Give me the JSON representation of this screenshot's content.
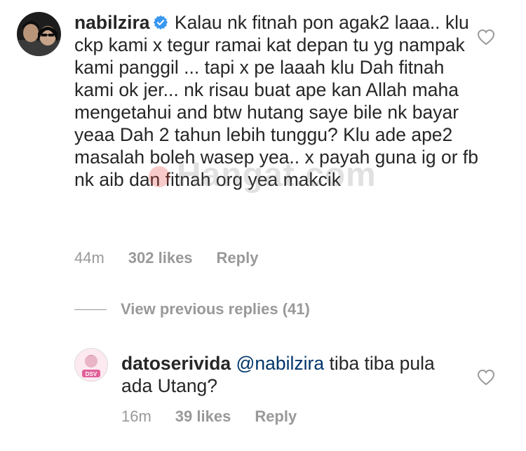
{
  "comment": {
    "username": "nabilzira",
    "text": "Kalau nk fitnah pon agak2 laaa.. klu ckp kami x tegur ramai kat depan tu yg nampak kami panggil ... tapi x pe laaah klu Dah fitnah kami ok jer... nk risau buat ape kan Allah maha mengetahui and btw hutang saye bile nk bayar yeaa Dah 2 tahun lebih tunggu? Klu  ade ape2 masalah boleh wasep yea.. x payah guna ig or fb nk aib dan fitnah org yea makcik",
    "time": "44m",
    "likes": "302 likes",
    "reply_label": "Reply",
    "verified_icon": "verified-badge-icon"
  },
  "view_previous_replies": "View previous replies (41)",
  "reply": {
    "username": "datoserivida",
    "mention": "@nabilzira",
    "text": " tiba tiba pula ada Utang?",
    "time": "16m",
    "likes": "39 likes",
    "reply_label": "Reply",
    "avatar_label": "DSV"
  },
  "watermark": "Hangat.com",
  "colors": {
    "text": "#262626",
    "muted": "#999999",
    "mention": "#003569",
    "verified": "#3897f0"
  }
}
